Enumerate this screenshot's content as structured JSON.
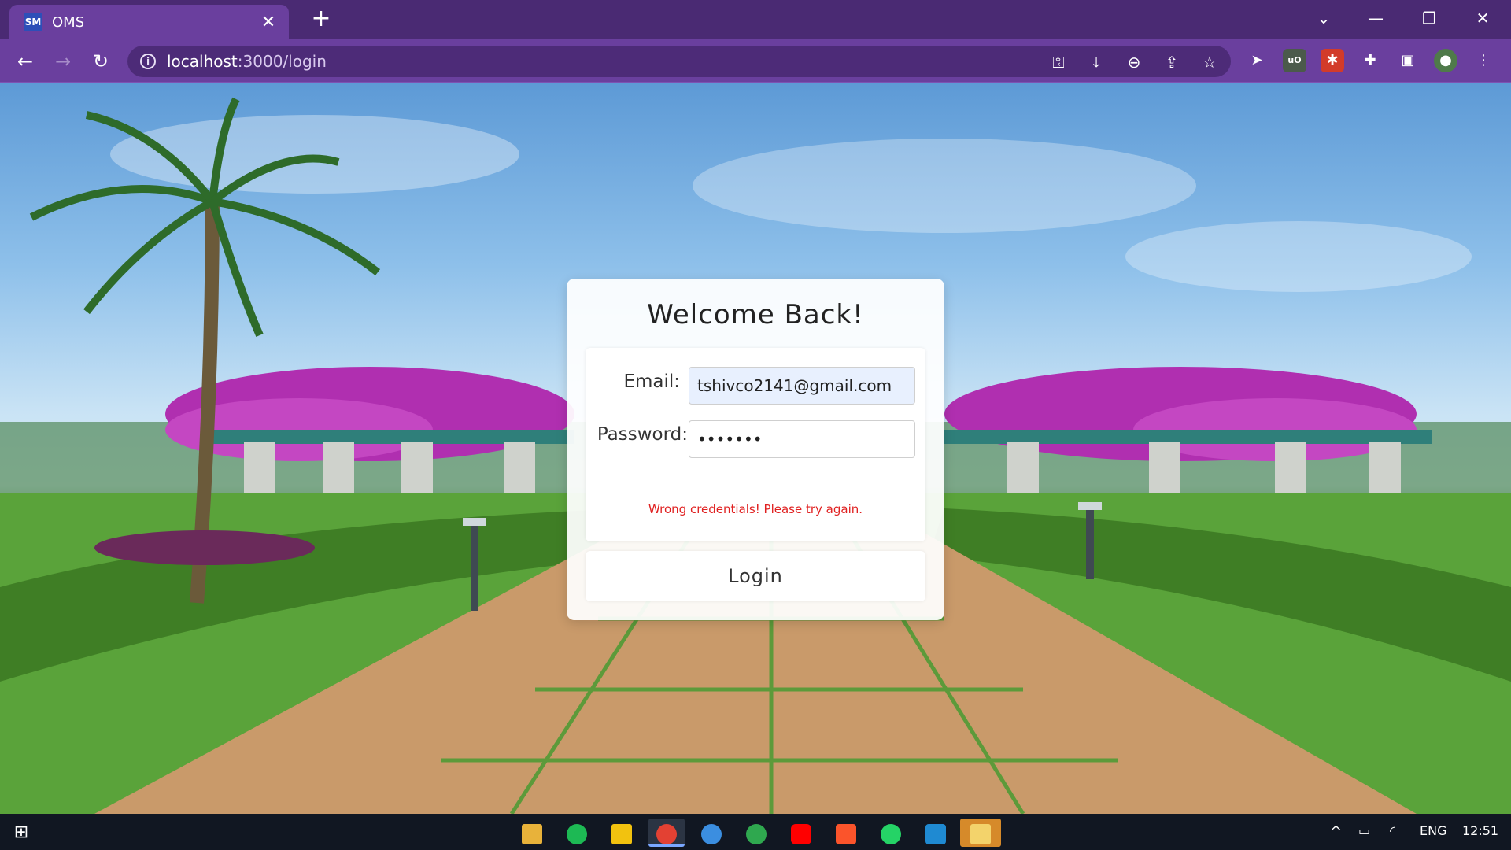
{
  "browser": {
    "tab": {
      "favicon_text": "SM",
      "title": "OMS"
    },
    "url_host": "localhost",
    "url_path": ":3000/login"
  },
  "login": {
    "title": "Welcome Back!",
    "email_label": "Email:",
    "email_value": "tshivco2141@gmail.com",
    "password_label": "Password:",
    "password_value": "•••••••",
    "error": "Wrong credentials! Please try again.",
    "submit_label": "Login"
  },
  "taskbar": {
    "language": "ENG",
    "time": "12:51"
  },
  "colors": {
    "browser_frame": "#4a2a73",
    "browser_toolbar": "#6a3f9e",
    "error": "#e02020",
    "taskbar": "#111722"
  },
  "icons": [
    "back-icon",
    "forward-icon",
    "reload-icon",
    "info-icon",
    "key-icon",
    "install-icon",
    "zoom-icon",
    "share-icon",
    "star-icon",
    "cursor-extension-icon",
    "ublock-icon",
    "ext-red-icon",
    "puzzle-icon",
    "side-panel-icon",
    "profile-avatar",
    "more-icon"
  ]
}
